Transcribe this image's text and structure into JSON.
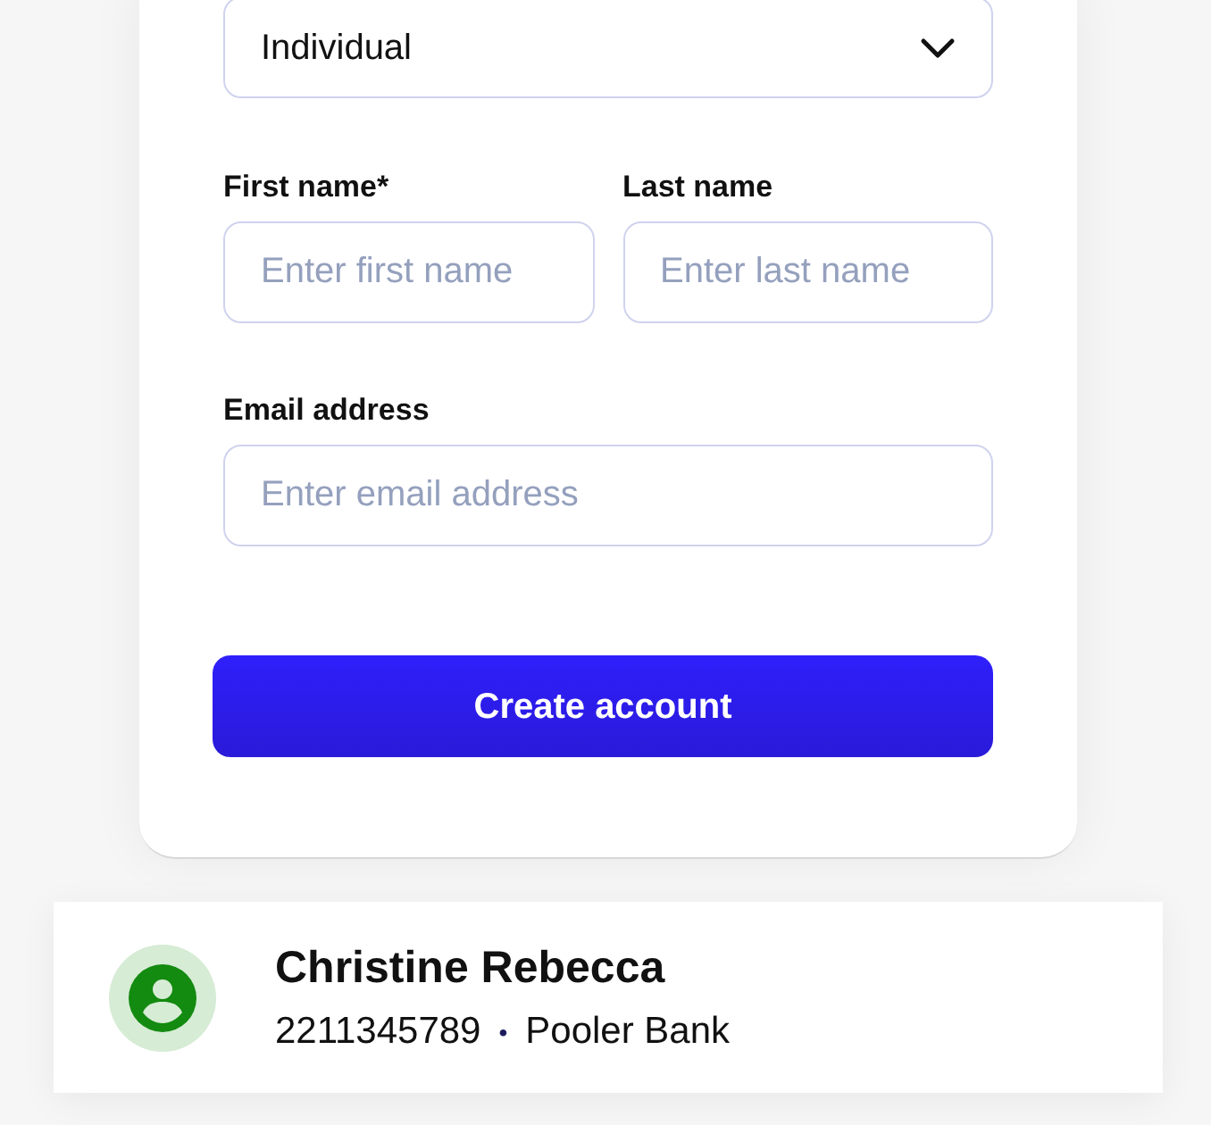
{
  "account_type_select": {
    "value": "Individual"
  },
  "fields": [
    {
      "label": "First name*",
      "placeholder": "Enter first name"
    },
    {
      "label": "Last name",
      "placeholder": "Enter last name"
    },
    {
      "label": "Email address",
      "placeholder": "Enter email address"
    }
  ],
  "submit_button": {
    "label": "Create account"
  },
  "contact_card": {
    "name": "Christine Rebecca",
    "account_number": "2211345789",
    "separator": "•",
    "bank": "Pooler Bank"
  }
}
